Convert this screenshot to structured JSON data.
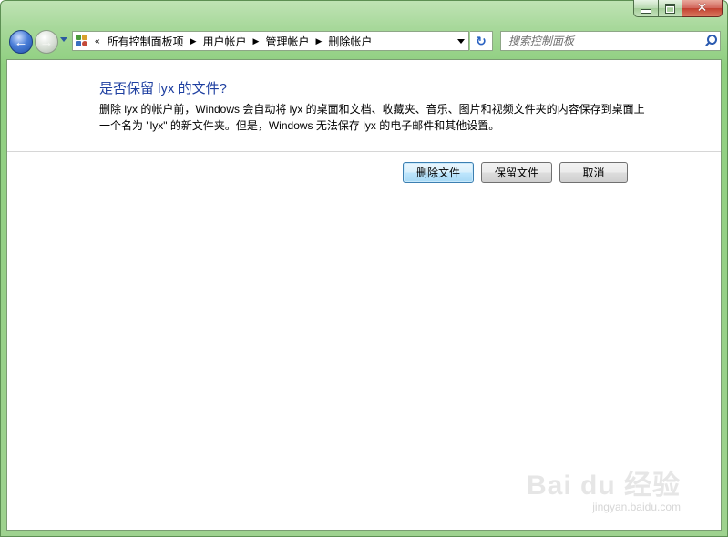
{
  "window": {
    "caption_buttons": {
      "minimize": "minimize",
      "maximize": "maximize",
      "close": "✕"
    }
  },
  "nav": {
    "back_glyph": "←",
    "forward_glyph": "→",
    "breadcrumb_overflow": "«",
    "breadcrumbs": [
      "所有控制面板项",
      "用户帐户",
      "管理帐户",
      "删除帐户"
    ],
    "refresh_glyph": "↻",
    "search_placeholder": "搜索控制面板"
  },
  "main": {
    "heading": "是否保留 lyx 的文件?",
    "description": "删除 lyx 的帐户前，Windows 会自动将 lyx 的桌面和文档、收藏夹、音乐、图片和视频文件夹的内容保存到桌面上一个名为 \"lyx\" 的新文件夹。但是，Windows 无法保存 lyx 的电子邮件和其他设置。",
    "buttons": {
      "delete_files": "删除文件",
      "keep_files": "保留文件",
      "cancel": "取消"
    }
  },
  "watermark": {
    "main": "Bai du 经验",
    "sub": "jingyan.baidu.com"
  },
  "colors": {
    "frame": "#9ed28f",
    "heading": "#1e3fa0",
    "default_button_border": "#3c7fb1"
  },
  "icons": [
    "back-arrow-icon",
    "forward-arrow-icon",
    "recent-pages-icon",
    "control-panel-icon",
    "chevron-right-icon",
    "dropdown-icon",
    "refresh-icon",
    "search-icon"
  ]
}
